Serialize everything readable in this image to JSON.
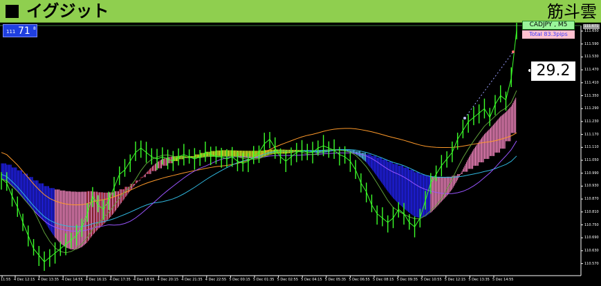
{
  "banner": {
    "title": "イグジット",
    "right_text": "筋斗雲"
  },
  "spread": {
    "prefix": "111",
    "value": "71",
    "suffix": "8"
  },
  "symbol": {
    "label": "CADJPY , M5",
    "total": "Total  83.3pips"
  },
  "readout": {
    "value": "29.2"
  },
  "price_tag": "111.671",
  "y_axis": {
    "labels": [
      "111.650",
      "111.590",
      "111.530",
      "111.470",
      "111.410",
      "111.350",
      "111.290",
      "111.230",
      "111.170",
      "111.110",
      "111.050",
      "110.990",
      "110.930",
      "110.870",
      "110.810",
      "110.750",
      "110.690",
      "110.630",
      "110.570"
    ]
  },
  "x_axis": {
    "labels": [
      "11:55",
      "4 Dec 12:15",
      "4 Dec 13:35",
      "4 Dec 14:55",
      "4 Dec 16:15",
      "4 Dec 17:35",
      "4 Dec 18:55",
      "4 Dec 20:15",
      "4 Dec 21:35",
      "4 Dec 22:55",
      "5 Dec 00:15",
      "5 Dec 01:35",
      "5 Dec 02:55",
      "5 Dec 04:15",
      "5 Dec 05:35",
      "5 Dec 06:55",
      "5 Dec 08:15",
      "5 Dec 09:35",
      "5 Dec 10:55",
      "5 Dec 12:15",
      "5 Dec 13:35",
      "5 Dec 14:55"
    ]
  },
  "colors": {
    "background": "#000000",
    "banner": "#8fcf4f",
    "price_line": "#3cff2a",
    "cloud_blue": "#2424ff",
    "cloud_red": "#c01818",
    "cloud_yellow": "#e8ff2a",
    "cloud_pink": "#ff8cc8",
    "cloud_cyan": "#59c9ff",
    "ma_orange": "#ff9a2a",
    "ma_cyan": "#30b8e0",
    "ma_purple": "#9a55ff"
  },
  "chart_data": {
    "type": "line",
    "title": "",
    "xlabel": "",
    "ylabel": "",
    "ylim": [
      110.54,
      111.68
    ],
    "series": [
      {
        "values": [
          110.98,
          110.96,
          110.9,
          110.85,
          110.78,
          110.72,
          110.66,
          110.63,
          110.6,
          110.62,
          110.64,
          110.66,
          110.68,
          110.7,
          110.72,
          110.76,
          110.82,
          110.9,
          110.86,
          110.84,
          110.88,
          110.94,
          111.0,
          111.02,
          111.06,
          111.1,
          111.12,
          111.1,
          111.08,
          111.07,
          111.08,
          111.07,
          111.06,
          111.08,
          111.09,
          111.08,
          111.07,
          111.08,
          111.1,
          111.09,
          111.08,
          111.08,
          111.07,
          111.08,
          111.06,
          111.05,
          111.06,
          111.08,
          111.1,
          111.14,
          111.16,
          111.12,
          111.08,
          111.06,
          111.08,
          111.1,
          111.11,
          111.1,
          111.1,
          111.12,
          111.13,
          111.12,
          111.11,
          111.09,
          111.08,
          111.06,
          111.02,
          110.96,
          110.92,
          110.86,
          110.82,
          110.8,
          110.78,
          110.8,
          110.84,
          110.82,
          110.78,
          110.76,
          110.8,
          110.88,
          110.96,
          111.0,
          111.04,
          111.07,
          111.1,
          111.16,
          111.2,
          111.24,
          111.26,
          111.28,
          111.3,
          111.26,
          111.32,
          111.36,
          111.34,
          111.44,
          111.66
        ]
      }
    ]
  }
}
